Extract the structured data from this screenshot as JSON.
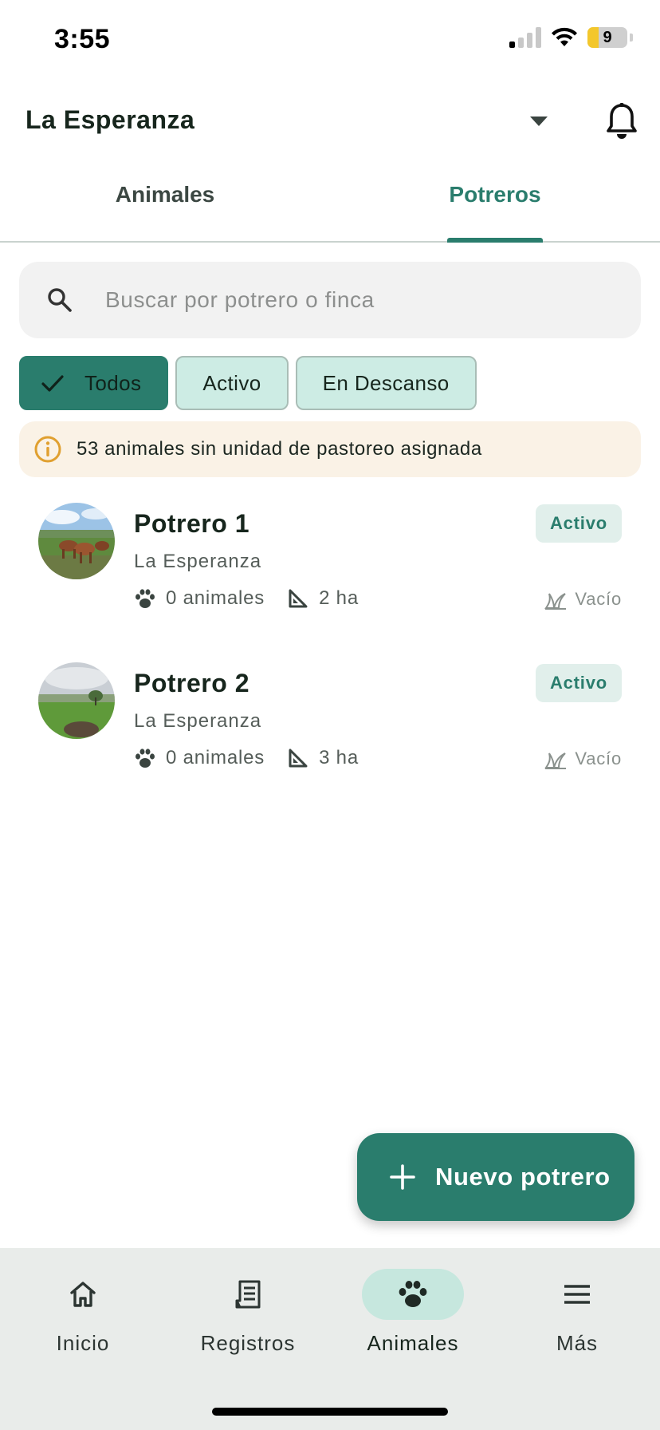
{
  "status_bar": {
    "time": "3:55",
    "battery_level": "9",
    "signal_bars_on": 1,
    "signal_bars_total": 4,
    "icons": [
      "cellular-signal-icon",
      "wifi-icon",
      "battery-icon"
    ]
  },
  "header": {
    "farm_name": "La Esperanza",
    "dropdown_icon": "caret-down-icon",
    "notifications_icon": "bell-icon"
  },
  "tabs": [
    {
      "label": "Animales",
      "active": false
    },
    {
      "label": "Potreros",
      "active": true
    }
  ],
  "search": {
    "placeholder": "Buscar por potrero o finca",
    "value": "",
    "icon": "search-icon"
  },
  "filters": [
    {
      "label": "Todos",
      "selected": true
    },
    {
      "label": "Activo",
      "selected": false
    },
    {
      "label": "En Descanso",
      "selected": false
    }
  ],
  "banner": {
    "icon": "info-icon",
    "text": "53 animales sin unidad de pastoreo asignada"
  },
  "paddocks": [
    {
      "name": "Potrero 1",
      "farm": "La Esperanza",
      "animals": "0 animales",
      "area": "2 ha",
      "status": "Activo",
      "load": "Vacío",
      "photo": "cattle-in-pasture-photo"
    },
    {
      "name": "Potrero 2",
      "farm": "La Esperanza",
      "animals": "0 animales",
      "area": "3 ha",
      "status": "Activo",
      "load": "Vacío",
      "photo": "green-field-photo"
    }
  ],
  "fab": {
    "label": "Nuevo potrero",
    "icon": "plus-icon"
  },
  "bottom_nav": [
    {
      "label": "Inicio",
      "icon": "home-icon",
      "active": false
    },
    {
      "label": "Registros",
      "icon": "records-icon",
      "active": false
    },
    {
      "label": "Animales",
      "icon": "paw-icon",
      "active": true
    },
    {
      "label": "Más",
      "icon": "menu-icon",
      "active": false
    }
  ],
  "colors": {
    "primary": "#2a7d6d",
    "chip_background": "#cdece4",
    "banner_background": "#faf2e6",
    "warning_icon": "#e0a030",
    "nav_background": "#e9ecea",
    "nav_active_pill": "#c6e7de"
  }
}
